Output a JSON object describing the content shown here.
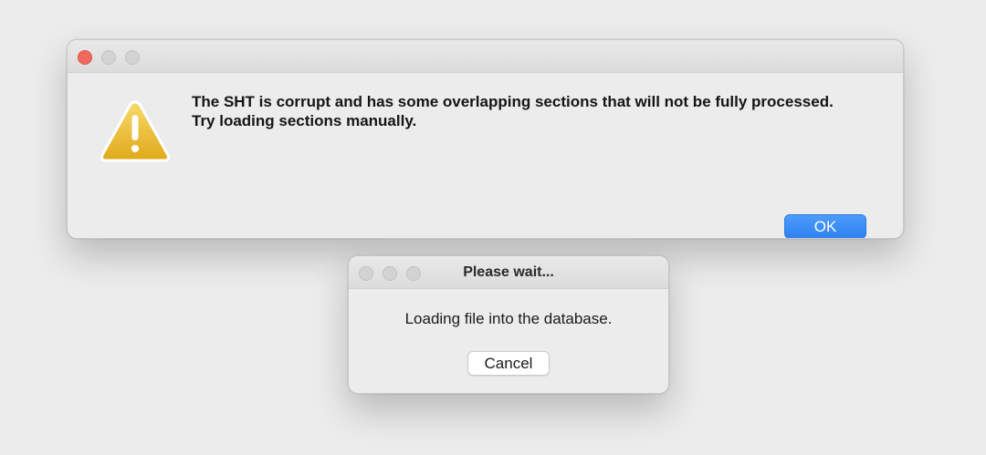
{
  "alert": {
    "icon": "warning-icon",
    "message_line1": "The SHT is corrupt and has some overlapping sections that will not be fully processed.",
    "message_line2": "Try loading sections manually.",
    "ok_label": "OK",
    "accent_color": "#3b8cf5"
  },
  "wait_dialog": {
    "title": "Please wait...",
    "message": "Loading file into the database.",
    "cancel_label": "Cancel"
  }
}
